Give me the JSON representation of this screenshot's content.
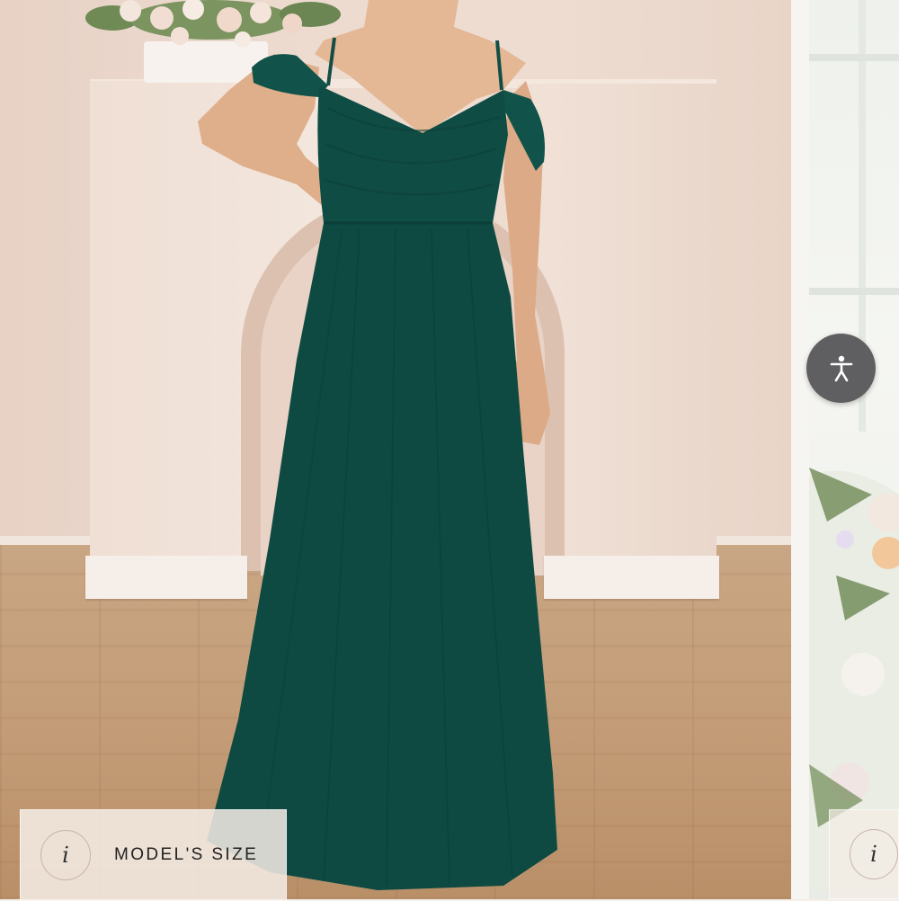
{
  "gallery": {
    "main_image": {
      "subject": "model wearing off-the-shoulder pleated chiffon gown",
      "dress_color": "#0f4c44"
    },
    "accessibility_button": {
      "icon": "accessibility-icon",
      "color": "#5f5f61"
    },
    "size_chip": {
      "icon_glyph": "i",
      "label": "MODEL'S SIZE"
    },
    "size_chip_next": {
      "icon_glyph": "i"
    }
  }
}
